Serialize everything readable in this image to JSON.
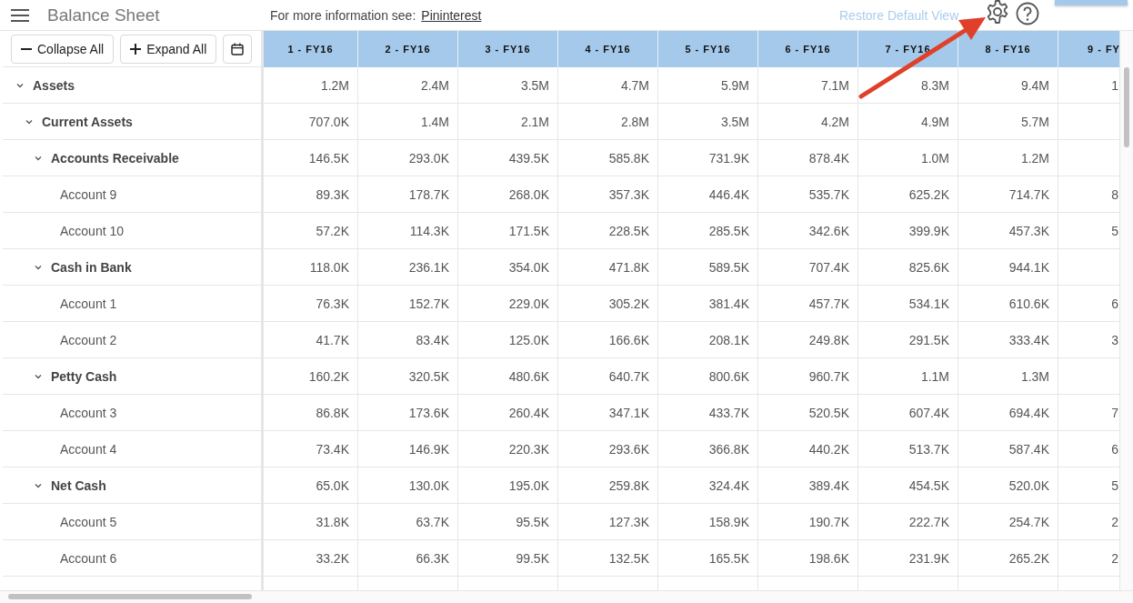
{
  "top_bar": {
    "title": "Balance Sheet",
    "info_label": "For more information see:",
    "info_link": "Pininterest",
    "restore_link": "Restore Default View"
  },
  "toolbar": {
    "buttons": [
      {
        "kind": "collapse",
        "label": "Collapse All"
      },
      {
        "kind": "expand",
        "label": "Expand All"
      },
      {
        "kind": "calendar"
      }
    ]
  },
  "table": {
    "columns": [
      "1 - FY16",
      "2 - FY16",
      "3 - FY16",
      "4 - FY16",
      "5 - FY16",
      "6 - FY16",
      "7 - FY16",
      "8 - FY16",
      "9 - FY"
    ],
    "rows": [
      {
        "label": "Assets",
        "expanded": true,
        "values": [
          "1.2M",
          "2.4M",
          "3.5M",
          "4.7M",
          "5.9M",
          "7.1M",
          "8.3M",
          "9.4M",
          "1"
        ],
        "children": [
          {
            "label": "Current Assets",
            "expanded": true,
            "values": [
              "707.0K",
              "1.4M",
              "2.1M",
              "2.8M",
              "3.5M",
              "4.2M",
              "4.9M",
              "5.7M"
            ],
            "children": [
              {
                "label": "Accounts Receivable",
                "expanded": true,
                "values": [
                  "146.5K",
                  "293.0K",
                  "439.5K",
                  "585.8K",
                  "731.9K",
                  "878.4K",
                  "1.0M",
                  "1.2M"
                ],
                "children": [
                  {
                    "label": "Account 9",
                    "values": [
                      "89.3K",
                      "178.7K",
                      "268.0K",
                      "357.3K",
                      "446.4K",
                      "535.7K",
                      "625.2K",
                      "714.7K",
                      "8"
                    ]
                  },
                  {
                    "label": "Account 10",
                    "values": [
                      "57.2K",
                      "114.3K",
                      "171.5K",
                      "228.5K",
                      "285.5K",
                      "342.6K",
                      "399.9K",
                      "457.3K",
                      "5"
                    ]
                  }
                ]
              },
              {
                "label": "Cash in Bank",
                "expanded": true,
                "values": [
                  "118.0K",
                  "236.1K",
                  "354.0K",
                  "471.8K",
                  "589.5K",
                  "707.4K",
                  "825.6K",
                  "944.1K"
                ],
                "children": [
                  {
                    "label": "Account 1",
                    "values": [
                      "76.3K",
                      "152.7K",
                      "229.0K",
                      "305.2K",
                      "381.4K",
                      "457.7K",
                      "534.1K",
                      "610.6K",
                      "6"
                    ]
                  },
                  {
                    "label": "Account 2",
                    "values": [
                      "41.7K",
                      "83.4K",
                      "125.0K",
                      "166.6K",
                      "208.1K",
                      "249.8K",
                      "291.5K",
                      "333.4K",
                      "3"
                    ]
                  }
                ]
              },
              {
                "label": "Petty Cash",
                "expanded": true,
                "values": [
                  "160.2K",
                  "320.5K",
                  "480.6K",
                  "640.7K",
                  "800.6K",
                  "960.7K",
                  "1.1M",
                  "1.3M"
                ],
                "children": [
                  {
                    "label": "Account 3",
                    "values": [
                      "86.8K",
                      "173.6K",
                      "260.4K",
                      "347.1K",
                      "433.7K",
                      "520.5K",
                      "607.4K",
                      "694.4K",
                      "7"
                    ]
                  },
                  {
                    "label": "Account 4",
                    "values": [
                      "73.4K",
                      "146.9K",
                      "220.3K",
                      "293.6K",
                      "366.8K",
                      "440.2K",
                      "513.7K",
                      "587.4K",
                      "6"
                    ]
                  }
                ]
              },
              {
                "label": "Net Cash",
                "expanded": true,
                "values": [
                  "65.0K",
                  "130.0K",
                  "195.0K",
                  "259.8K",
                  "324.4K",
                  "389.4K",
                  "454.5K",
                  "520.0K",
                  "5"
                ],
                "children": [
                  {
                    "label": "Account 5",
                    "values": [
                      "31.8K",
                      "63.7K",
                      "95.5K",
                      "127.3K",
                      "158.9K",
                      "190.7K",
                      "222.7K",
                      "254.7K",
                      "2"
                    ]
                  },
                  {
                    "label": "Account 6",
                    "values": [
                      "33.2K",
                      "66.3K",
                      "99.5K",
                      "132.5K",
                      "165.5K",
                      "198.6K",
                      "231.9K",
                      "265.2K",
                      "2"
                    ]
                  }
                ]
              }
            ]
          }
        ]
      }
    ]
  }
}
